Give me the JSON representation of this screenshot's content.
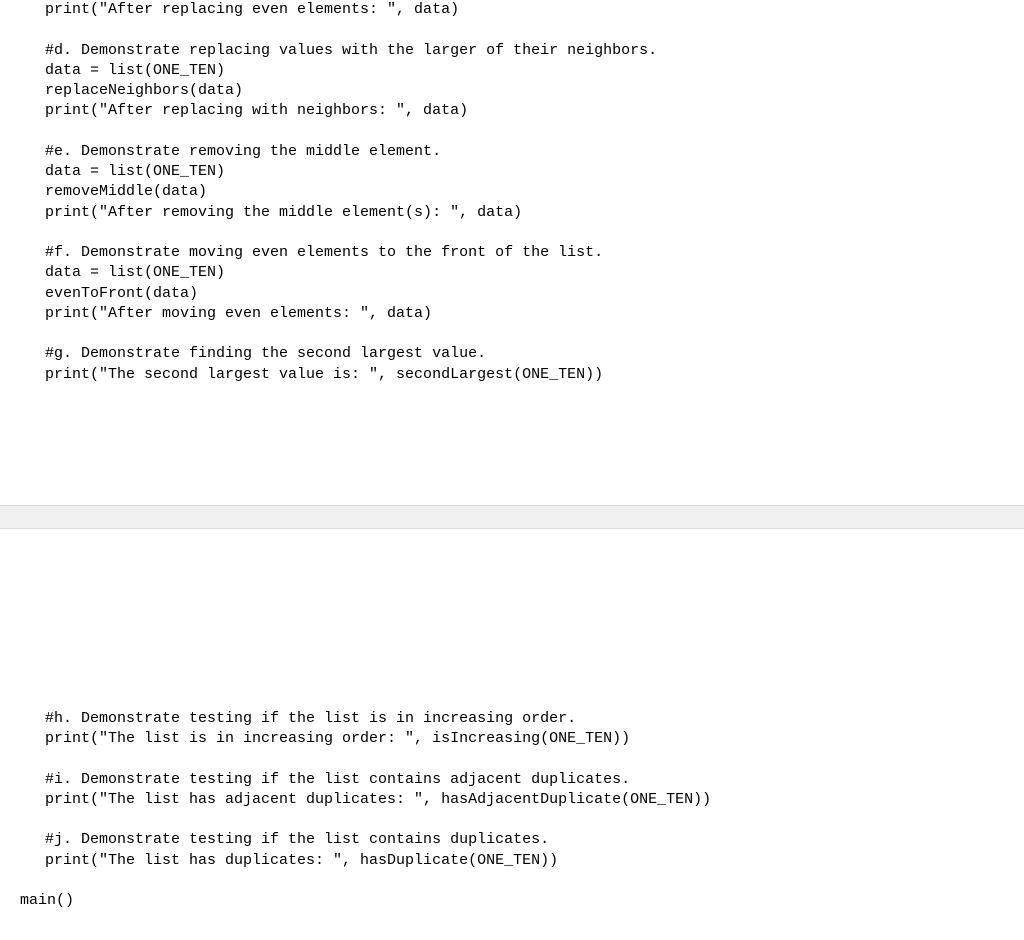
{
  "top": {
    "line01": "print(\"After replacing even elements: \", data)",
    "blank1": "",
    "line02": "#d. Demonstrate replacing values with the larger of their neighbors.",
    "line03": "data = list(ONE_TEN)",
    "line04": "replaceNeighbors(data)",
    "line05": "print(\"After replacing with neighbors: \", data)",
    "blank2": "",
    "line06": "#e. Demonstrate removing the middle element.",
    "line07": "data = list(ONE_TEN)",
    "line08": "removeMiddle(data)",
    "line09": "print(\"After removing the middle element(s): \", data)",
    "blank3": "",
    "line10": "#f. Demonstrate moving even elements to the front of the list.",
    "line11": "data = list(ONE_TEN)",
    "line12": "evenToFront(data)",
    "line13": "print(\"After moving even elements: \", data)",
    "blank4": "",
    "line14": "#g. Demonstrate finding the second largest value.",
    "line15": "print(\"The second largest value is: \", secondLargest(ONE_TEN))"
  },
  "bottom": {
    "line01": "#h. Demonstrate testing if the list is in increasing order.",
    "line02": "print(\"The list is in increasing order: \", isIncreasing(ONE_TEN))",
    "blank1": "",
    "line03": "#i. Demonstrate testing if the list contains adjacent duplicates.",
    "line04": "print(\"The list has adjacent duplicates: \", hasAdjacentDuplicate(ONE_TEN))",
    "blank2": "",
    "line05": "#j. Demonstrate testing if the list contains duplicates.",
    "line06": "print(\"The list has duplicates: \", hasDuplicate(ONE_TEN))",
    "blank3": "",
    "main": "main()"
  }
}
